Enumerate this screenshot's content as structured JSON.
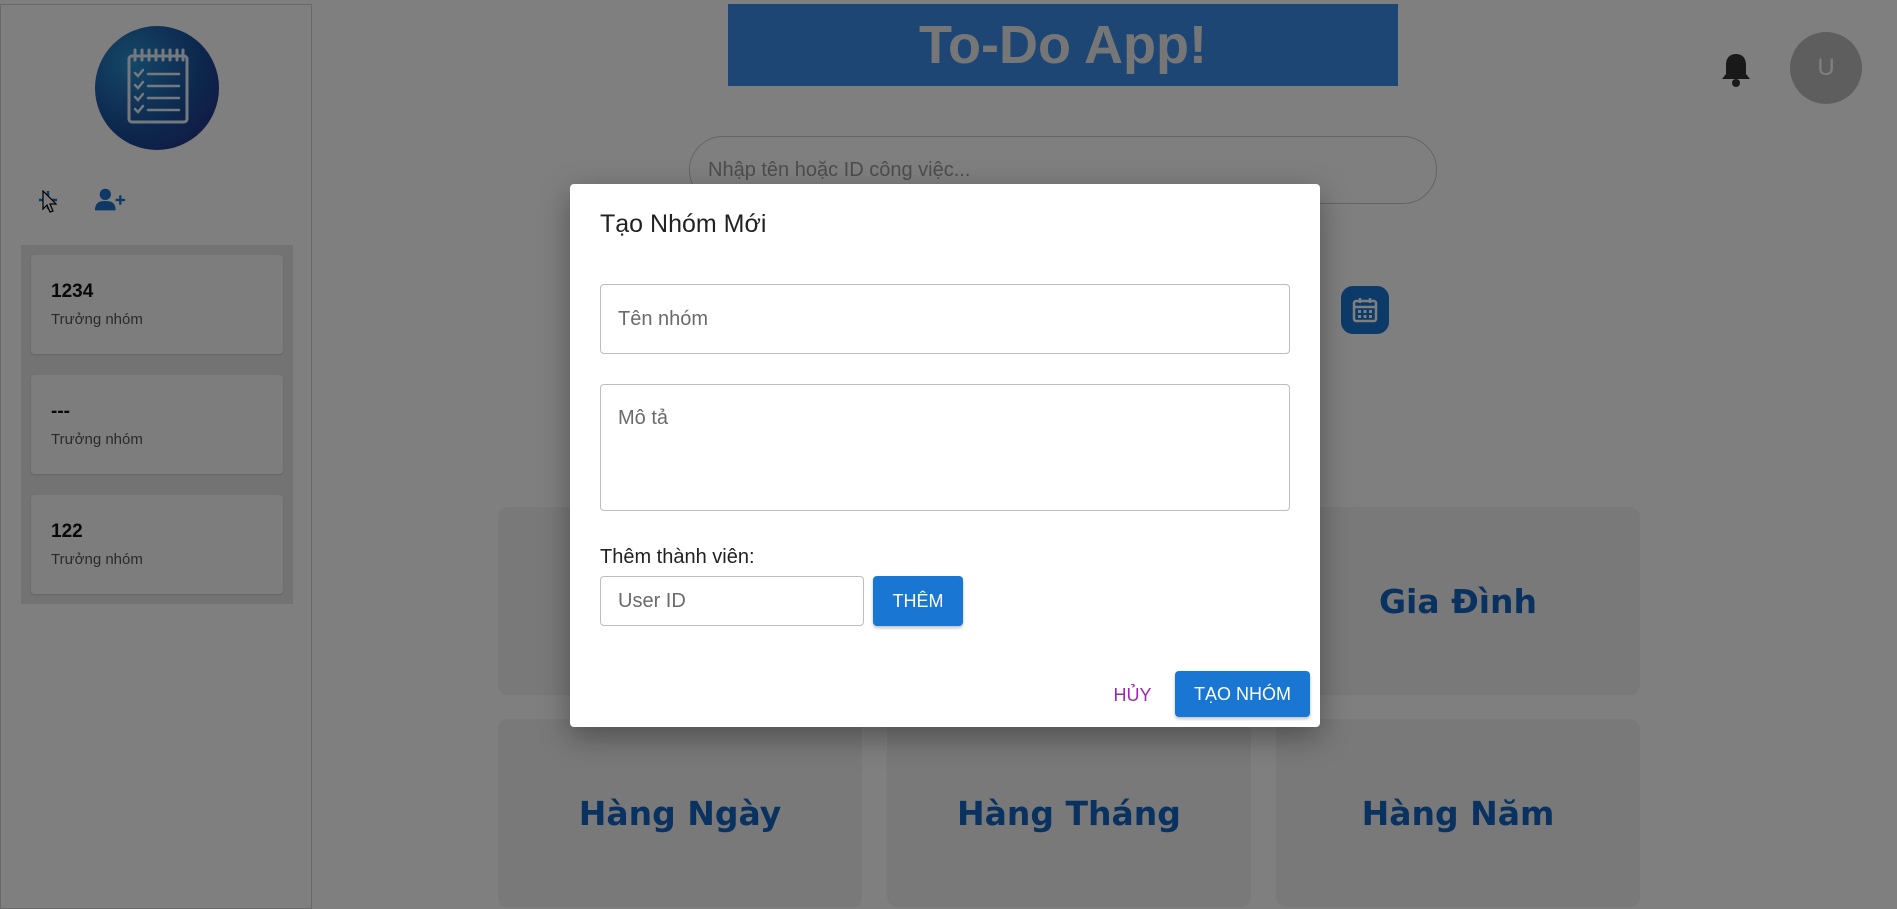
{
  "colors": {
    "primary": "#1976d2",
    "cancel": "#9c27b0",
    "tile_text": "#1565c0",
    "banner": "#3b8ce8"
  },
  "sidebar": {
    "logo_icon": "notepad-checklist-icon",
    "actions": [
      {
        "icon": "plus-icon"
      },
      {
        "icon": "add-user-icon"
      }
    ],
    "groups": [
      {
        "name": "1234",
        "role": "Trưởng nhóm"
      },
      {
        "name": "---",
        "role": "Trưởng nhóm"
      },
      {
        "name": "122",
        "role": "Trưởng nhóm"
      }
    ]
  },
  "header": {
    "title": "To-Do App!",
    "notification_icon": "bell-icon",
    "avatar_initial": "U"
  },
  "search": {
    "placeholder": "Nhập tên hoặc ID công việc..."
  },
  "calendar_icon": "calendar-icon",
  "categories": {
    "family": "Gia Đình",
    "daily": "Hàng Ngày",
    "monthly": "Hàng Tháng",
    "yearly": "Hàng Năm"
  },
  "dialog": {
    "title": "Tạo Nhóm Mới",
    "name_placeholder": "Tên nhóm",
    "description_placeholder": "Mô tả",
    "members_label": "Thêm thành viên:",
    "user_id_placeholder": "User ID",
    "add_button": "THÊM",
    "cancel_button": "HỦY",
    "create_button": "TẠO NHÓM"
  }
}
